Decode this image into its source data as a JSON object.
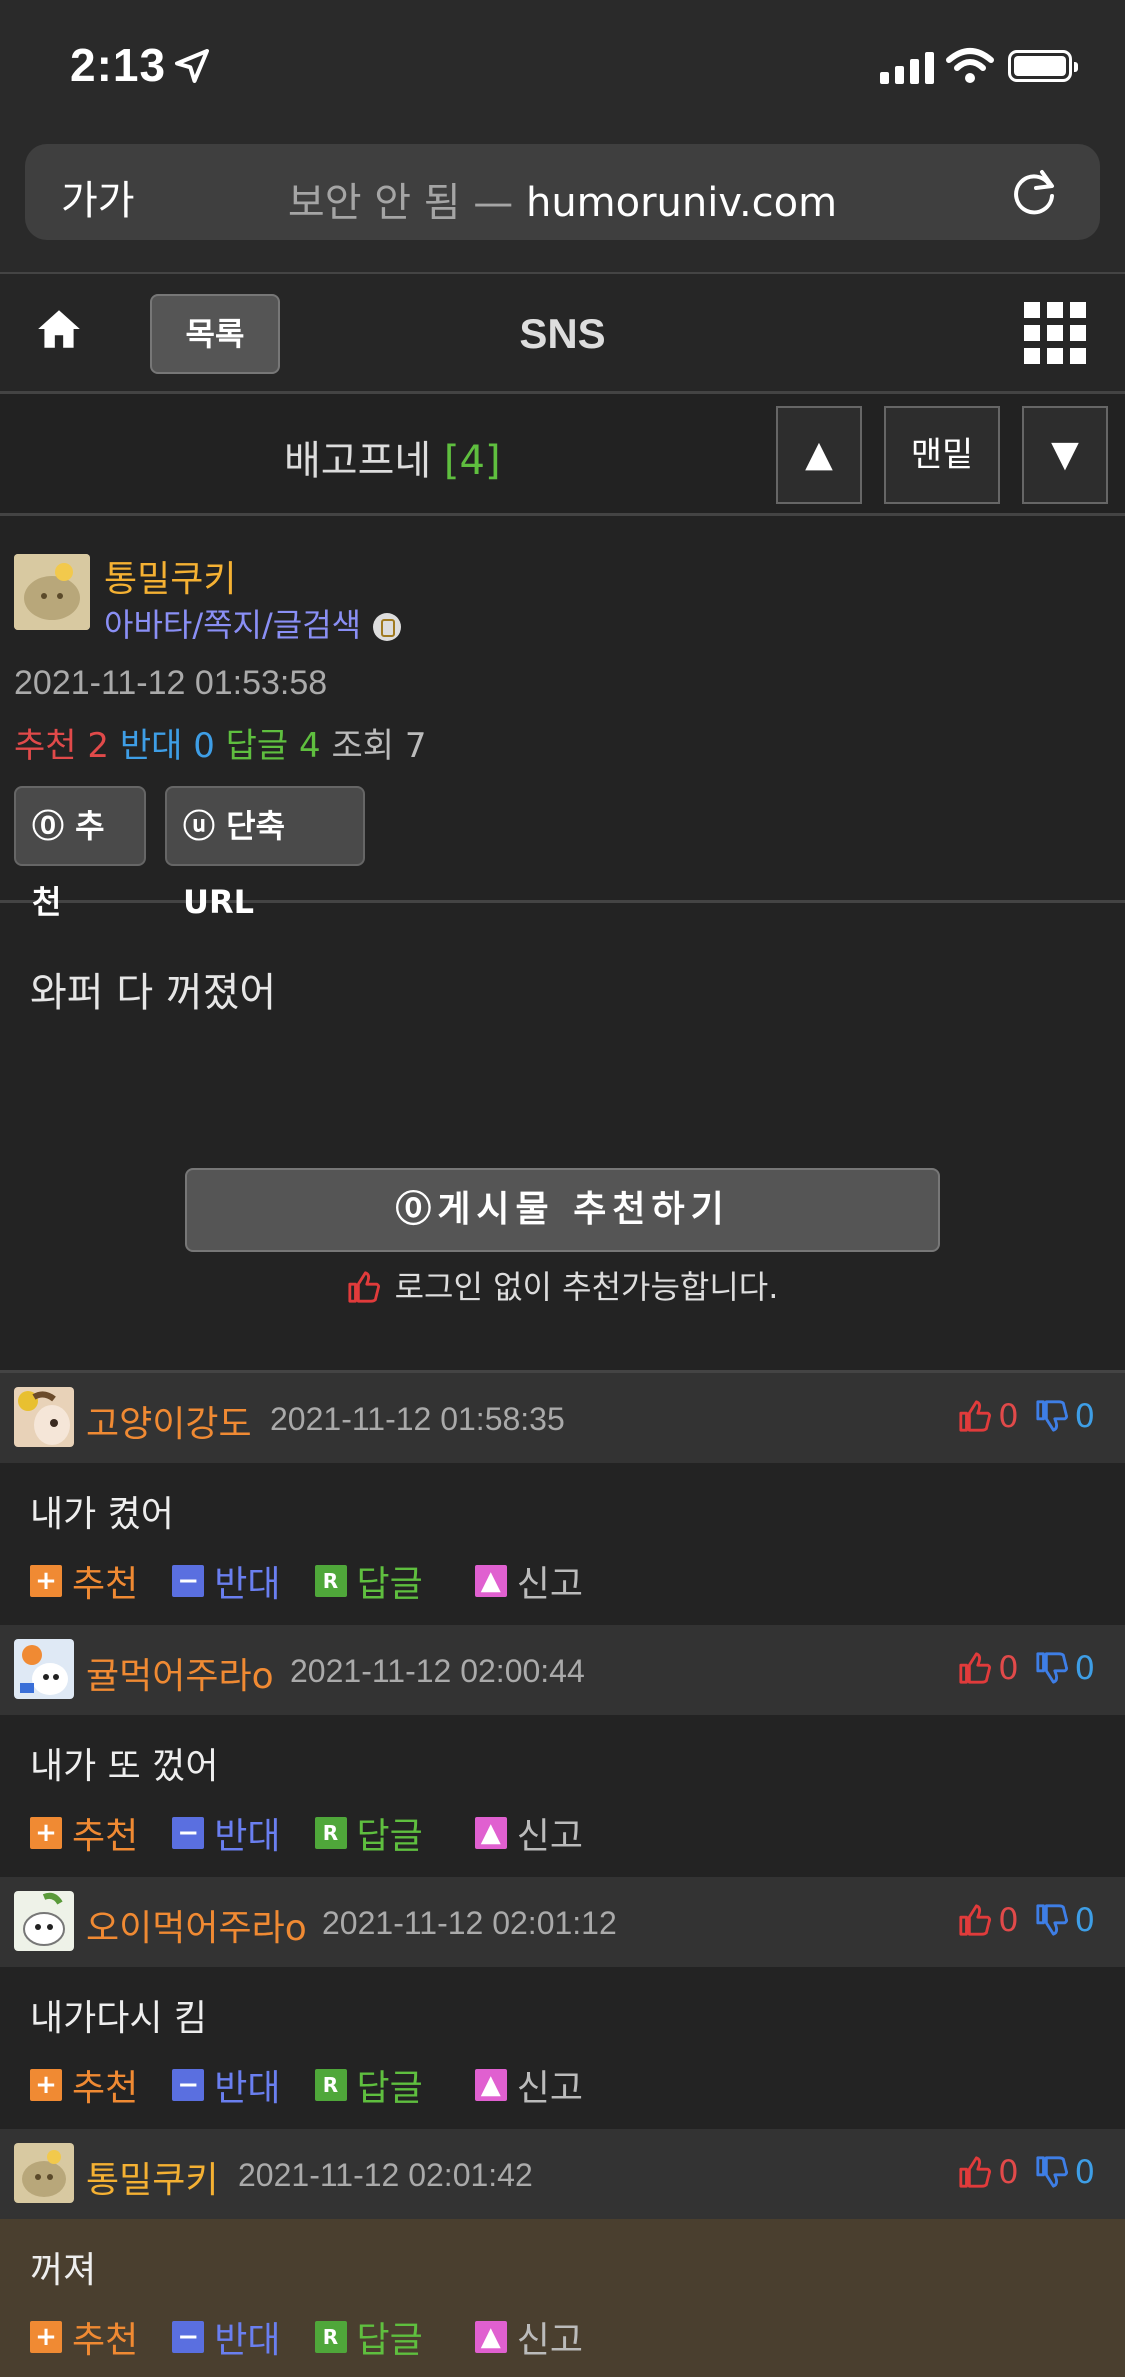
{
  "status_bar": {
    "time": "2:13"
  },
  "browser": {
    "text_size_label": "가가",
    "insecure_label": "보안 안 됨",
    "separator": " — ",
    "domain": "humoruniv.com"
  },
  "nav": {
    "list_label": "목록",
    "title": "SNS"
  },
  "board": {
    "name": "배고프네",
    "count": "[4]",
    "up_label": "▲",
    "bottom_label": "맨밑",
    "down_label": "▼"
  },
  "post": {
    "author": "통밀쿠키",
    "author_links": "아바타/쪽지/글검색",
    "date": "2021-11-12 01:53:58",
    "stats": {
      "rec_label": "추천",
      "rec": "2",
      "opp_label": "반대",
      "opp": "0",
      "reply_label": "답글",
      "reply": "4",
      "view_label": "조회",
      "view": "7"
    },
    "rec_button": "⓪ 추천",
    "url_button": "ⓤ 단축URL",
    "content": "와퍼 다 꺼졌어",
    "big_rec_button": "⓪게시물  추천하기",
    "rec_note": "로그인 없이 추천가능합니다."
  },
  "comment_actions": {
    "rec": "추천",
    "opp": "반대",
    "reply": "답글",
    "report": "신고"
  },
  "comments": [
    {
      "nick": "고양이강도",
      "time": "2021-11-12 01:58:35",
      "up": "0",
      "down": "0",
      "text": "내가 켰어"
    },
    {
      "nick": "귤먹어주라o",
      "time": "2021-11-12 02:00:44",
      "up": "0",
      "down": "0",
      "text": "내가 또 껐어"
    },
    {
      "nick": "오이먹어주라o",
      "time": "2021-11-12 02:01:12",
      "up": "0",
      "down": "0",
      "text": "내가다시 킴"
    },
    {
      "nick": "통밀쿠키",
      "time": "2021-11-12 02:01:42",
      "up": "0",
      "down": "0",
      "text": "꺼져"
    }
  ],
  "colors": {
    "author": "#f5b133",
    "commenter": "#f08a33",
    "recommend": "#e14a4a",
    "oppose": "#3e9ee6",
    "reply": "#5fbf3f",
    "own_comment_bg": "#4a3f2f"
  }
}
